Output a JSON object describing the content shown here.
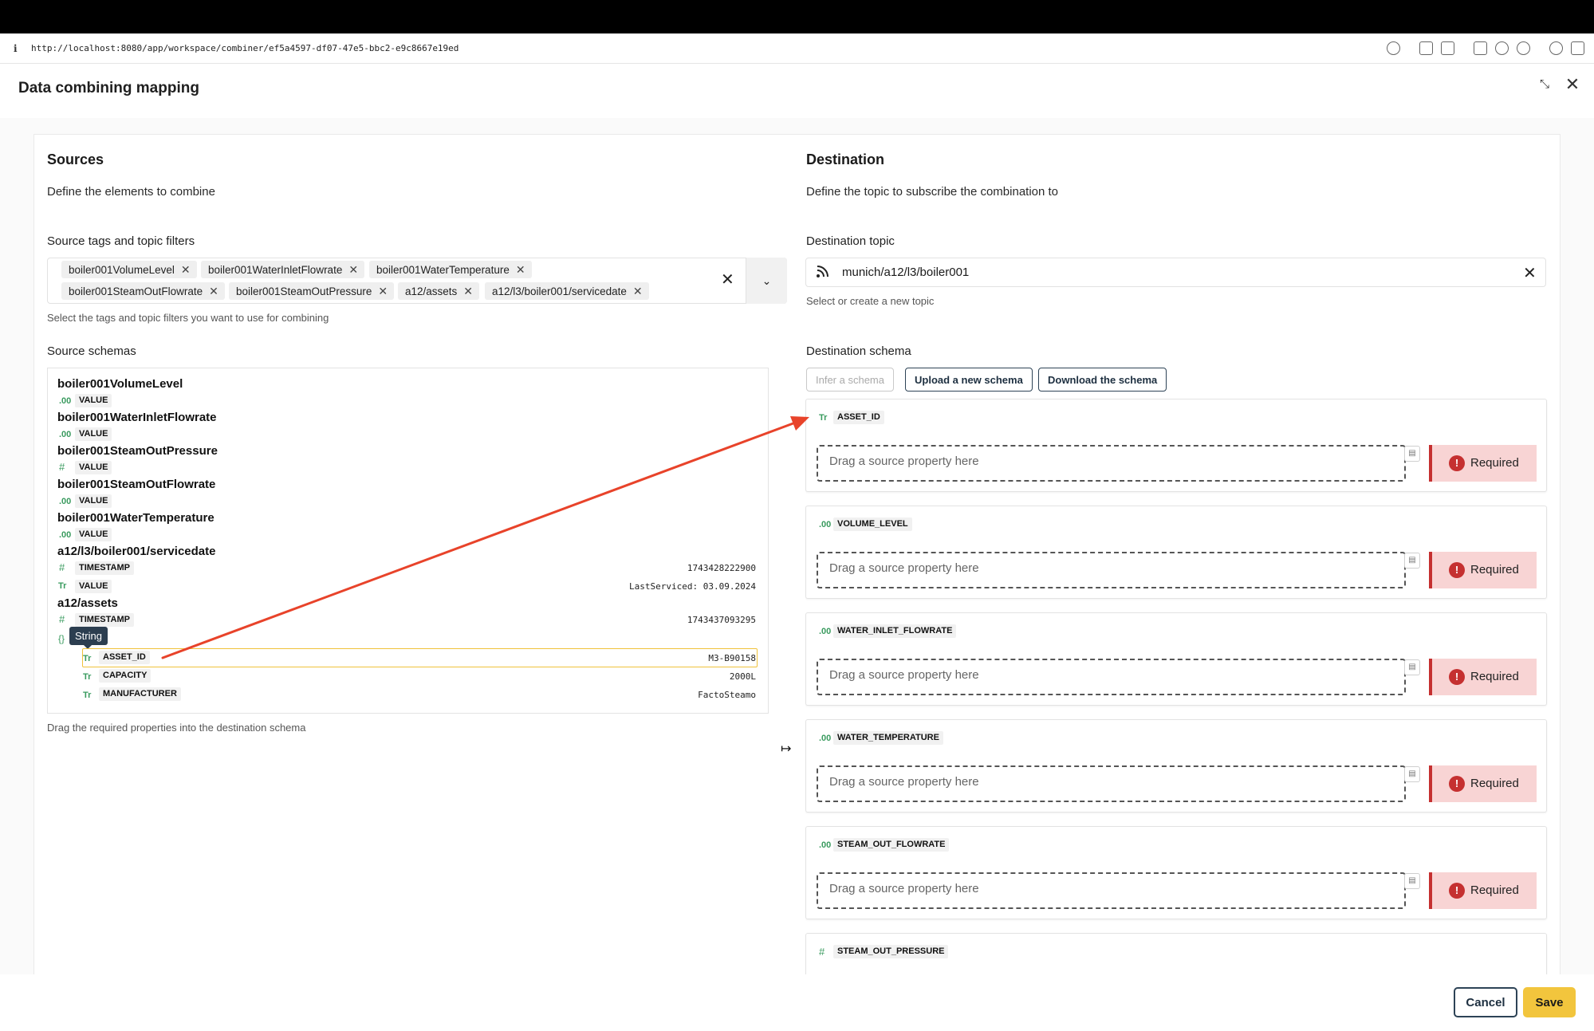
{
  "browser": {
    "url": "http://localhost:8080/app/workspace/combiner/ef5a4597-df07-47e5-bbc2-e9c8667e19ed"
  },
  "modal": {
    "title": "Data combining mapping"
  },
  "sources": {
    "title": "Sources",
    "description": "Define the elements to combine",
    "tags_label": "Source tags and topic filters",
    "tags": [
      "boiler001VolumeLevel",
      "boiler001WaterInletFlowrate",
      "boiler001WaterTemperature",
      "boiler001SteamOutFlowrate",
      "boiler001SteamOutPressure",
      "a12/assets",
      "a12/l3/boiler001/servicedate"
    ],
    "tags_help": "Select the tags and topic filters you want to use for combining",
    "schemas_label": "Source schemas",
    "schemas": [
      {
        "title": "boiler001VolumeLevel",
        "props": [
          {
            "type": "number",
            "icon": ".00",
            "name": "VALUE",
            "value": ""
          }
        ]
      },
      {
        "title": "boiler001WaterInletFlowrate",
        "props": [
          {
            "type": "number",
            "icon": ".00",
            "name": "VALUE",
            "value": ""
          }
        ]
      },
      {
        "title": "boiler001SteamOutPressure",
        "props": [
          {
            "type": "integer",
            "icon": "#",
            "name": "VALUE",
            "value": ""
          }
        ]
      },
      {
        "title": "boiler001SteamOutFlowrate",
        "props": [
          {
            "type": "number",
            "icon": ".00",
            "name": "VALUE",
            "value": ""
          }
        ]
      },
      {
        "title": "boiler001WaterTemperature",
        "props": [
          {
            "type": "number",
            "icon": ".00",
            "name": "VALUE",
            "value": ""
          }
        ]
      },
      {
        "title": "a12/l3/boiler001/servicedate",
        "props": [
          {
            "type": "integer",
            "icon": "#",
            "name": "TIMESTAMP",
            "value": "1743428222900"
          },
          {
            "type": "string",
            "icon": "Tr",
            "name": "VALUE",
            "value": "LastServiced: 03.09.2024"
          }
        ]
      },
      {
        "title": "a12/assets",
        "props": [
          {
            "type": "integer",
            "icon": "#",
            "name": "TIMESTAMP",
            "value": "1743437093295"
          }
        ]
      }
    ],
    "object_icon": "{}",
    "nested_props": [
      {
        "type": "string",
        "icon": "Tr",
        "name": "ASSET_ID",
        "value": "M3-B90158"
      },
      {
        "type": "string",
        "icon": "Tr",
        "name": "CAPACITY",
        "value": "2000L"
      },
      {
        "type": "string",
        "icon": "Tr",
        "name": "MANUFACTURER",
        "value": "FactoSteamo"
      }
    ],
    "tooltip": "String",
    "schemas_help": "Drag the required properties into the destination schema"
  },
  "destination": {
    "title": "Destination",
    "description": "Define the topic to subscribe the combination to",
    "topic_label": "Destination topic",
    "topic_value": "munich/a12/l3/boiler001",
    "topic_help": "Select or create a new topic",
    "schema_label": "Destination schema",
    "buttons": {
      "infer": "Infer a schema",
      "upload": "Upload a new schema",
      "download": "Download the schema"
    },
    "drop_placeholder": "Drag a source property here",
    "required_label": "Required",
    "trash_icon": "trash-icon",
    "props": [
      {
        "icon": "Tr",
        "name": "ASSET_ID"
      },
      {
        "icon": ".00",
        "name": "VOLUME_LEVEL"
      },
      {
        "icon": ".00",
        "name": "WATER_INLET_FLOWRATE"
      },
      {
        "icon": ".00",
        "name": "WATER_TEMPERATURE"
      },
      {
        "icon": ".00",
        "name": "STEAM_OUT_FLOWRATE"
      },
      {
        "icon": "#",
        "name": "STEAM_OUT_PRESSURE"
      }
    ]
  },
  "footer": {
    "cancel": "Cancel",
    "save": "Save"
  },
  "colors": {
    "type_icon": "#3a9b5f",
    "annotation_arrow": "#e8432a",
    "required_bg": "#f8d4d4",
    "required_accent": "#c53030",
    "primary": "#f2c53d",
    "highlight": "#f0c23b"
  }
}
